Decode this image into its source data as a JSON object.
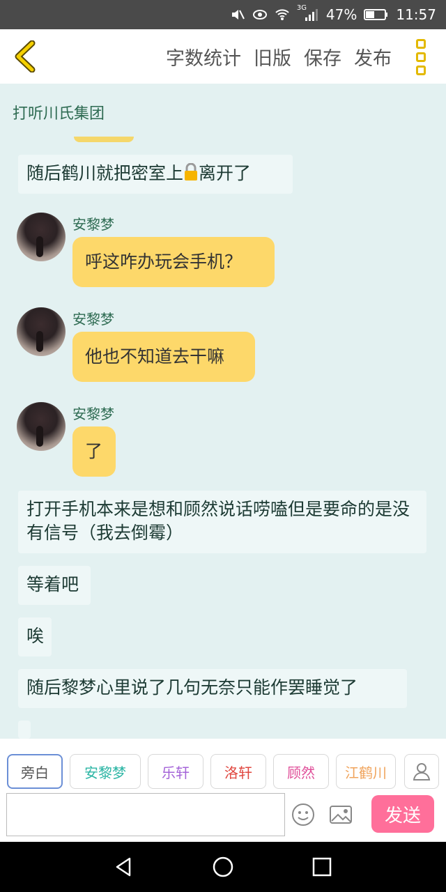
{
  "status": {
    "battery": "47%",
    "time": "11:57",
    "network": "3G"
  },
  "toolbar": {
    "word_count": "字数统计",
    "old_version": "旧版",
    "save": "保存",
    "publish": "发布"
  },
  "chat": {
    "title": "打听川氏集团",
    "narr1_before_lock": "随后鹤川就把密室上",
    "narr1_after_lock": "离开了",
    "messages": [
      {
        "speaker": "安黎梦",
        "text": "呼这咋办玩会手机？"
      },
      {
        "speaker": "安黎梦",
        "text": "他也不知道去干嘛"
      },
      {
        "speaker": "安黎梦",
        "text": "了"
      }
    ],
    "narr2": "打开手机本来是想和顾然说话唠嗑但是要命的是没有信号（我去倒霉）",
    "narr3": "等着吧",
    "narr4": "唉",
    "narr5": "随后黎梦心里说了几句无奈只能作罢睡觉了"
  },
  "roles": [
    {
      "label": "旁白",
      "color": "#555555"
    },
    {
      "label": "安黎梦",
      "color": "#2bb5a4"
    },
    {
      "label": "乐轩",
      "color": "#a463d8"
    },
    {
      "label": "洛轩",
      "color": "#e0473f"
    },
    {
      "label": "顾然",
      "color": "#e0509a"
    },
    {
      "label": "江鹤川",
      "color": "#f0a45c"
    }
  ],
  "input": {
    "value": "",
    "placeholder": ""
  },
  "send_label": "发送"
}
